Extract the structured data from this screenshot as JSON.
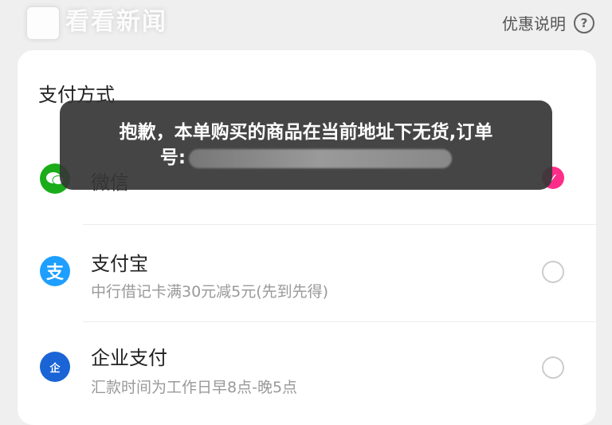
{
  "watermark": {
    "text": "看看新闻"
  },
  "header": {
    "promo_link": "优惠说明",
    "help_glyph": "?"
  },
  "section_title": "支付方式",
  "toast": {
    "line1": "抱歉，本单购买的商品在当前地址下无货,订单",
    "line2_prefix": "号:"
  },
  "methods": [
    {
      "name": "微信",
      "subtitle": "",
      "selected": true,
      "icon": "wechat-icon",
      "color": "#1aad19"
    },
    {
      "name": "支付宝",
      "subtitle": "中行借记卡满30元减5元(先到先得)",
      "selected": false,
      "icon": "alipay-icon",
      "color": "#1e9fff"
    },
    {
      "name": "企业支付",
      "subtitle": "汇款时间为工作日早8点-晚5点",
      "selected": false,
      "icon": "enterprise-pay-icon",
      "color": "#1a64d6"
    }
  ],
  "colors": {
    "accent": "#ff2d8a",
    "card": "#ffffff",
    "background": "#efefef"
  }
}
